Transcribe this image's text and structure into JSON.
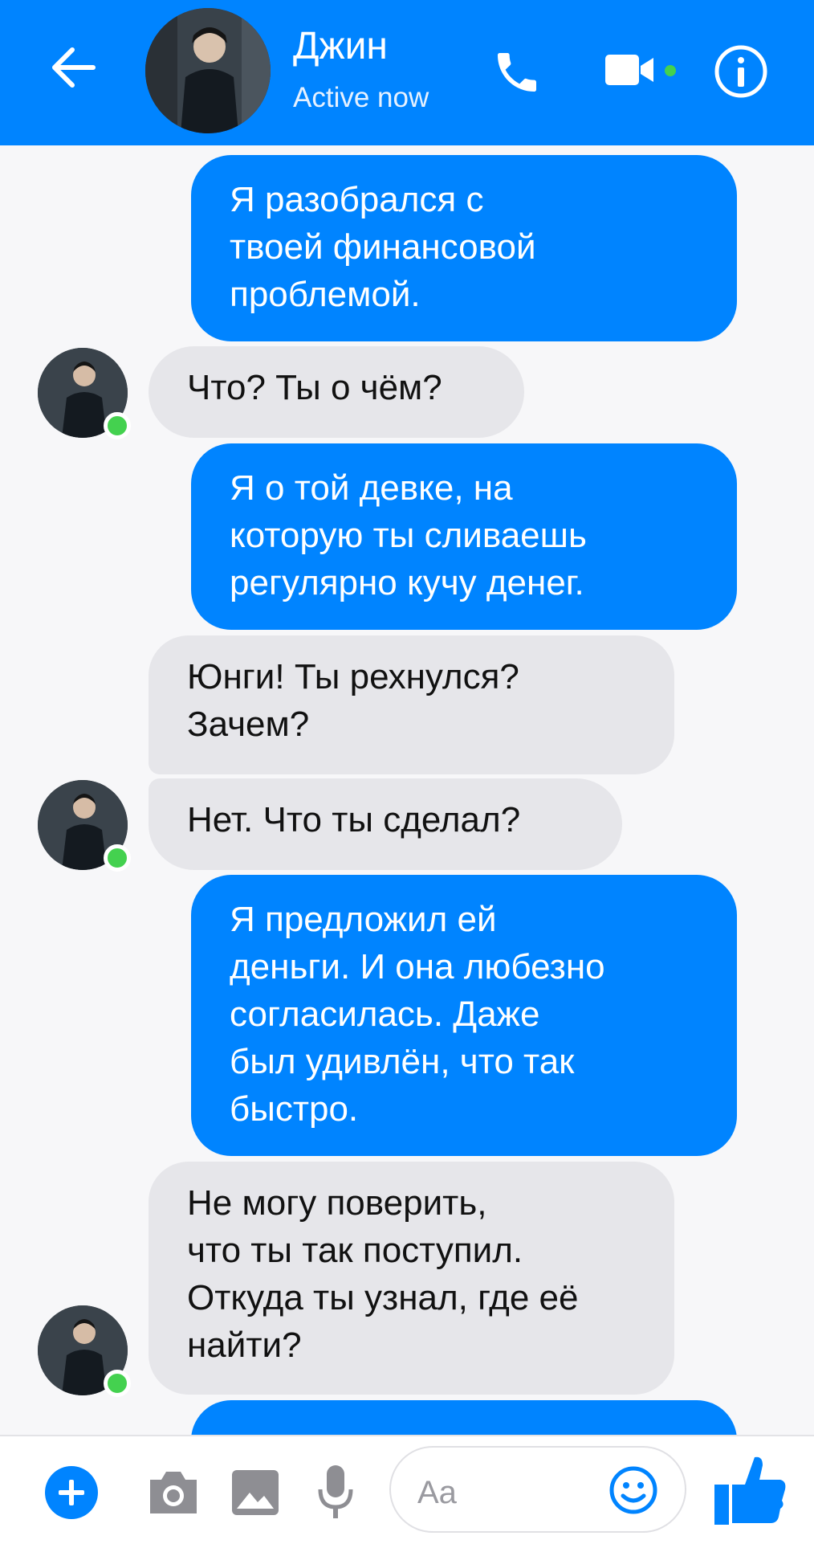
{
  "header": {
    "contact_name": "Джин",
    "status": "Active now",
    "icons": [
      "back-arrow-icon",
      "phone-icon",
      "video-camera-icon",
      "info-icon"
    ]
  },
  "messages": [
    {
      "side": "outgoing",
      "text": "Я разобрался с\nтвоей финансовой\nпроблемой."
    },
    {
      "side": "incoming",
      "text": "Что? Ты о чём?"
    },
    {
      "side": "outgoing",
      "text": "Я о той девке, на\nкоторую ты сливаешь\nрегулярно кучу денег."
    },
    {
      "side": "incoming",
      "text": "Юнги! Ты рехнулся?\nЗачем?"
    },
    {
      "side": "incoming",
      "text": "Нет. Что ты сделал?"
    },
    {
      "side": "outgoing",
      "text": "Я предложил ей\nденьги. И она любезно\nсогласилась. Даже\nбыл удивлён, что так\nбыстро."
    },
    {
      "side": "incoming",
      "text": "Не могу поверить,\nчто ты так поступил.\nОткуда ты узнал, где её\nнайти?"
    }
  ],
  "composer": {
    "placeholder": "Aa",
    "icons": [
      "plus-icon",
      "camera-icon",
      "image-icon",
      "microphone-icon",
      "emoji-icon",
      "thumbs-up-icon"
    ]
  },
  "colors": {
    "brand_blue": "#0084ff",
    "incoming_bubble": "#e6e6ea",
    "online_green": "#44d14f"
  }
}
